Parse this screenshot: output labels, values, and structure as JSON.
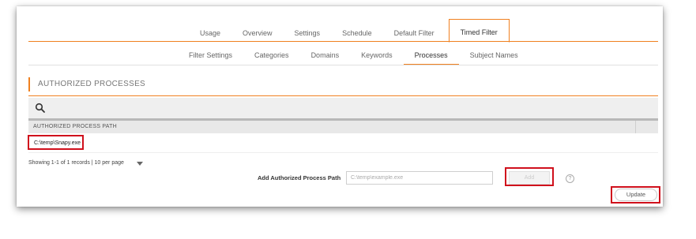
{
  "main_tabs": [
    {
      "label": "Usage"
    },
    {
      "label": "Overview"
    },
    {
      "label": "Settings"
    },
    {
      "label": "Schedule"
    },
    {
      "label": "Default Filter"
    },
    {
      "label": "Timed Filter",
      "active": true
    }
  ],
  "sub_tabs": [
    {
      "label": "Filter Settings"
    },
    {
      "label": "Categories"
    },
    {
      "label": "Domains"
    },
    {
      "label": "Keywords"
    },
    {
      "label": "Processes",
      "active": true
    },
    {
      "label": "Subject Names"
    }
  ],
  "section": {
    "title": "AUTHORIZED PROCESSES"
  },
  "search": {
    "icon": "search-icon"
  },
  "table": {
    "header": "AUTHORIZED PROCESS PATH",
    "rows": [
      {
        "path": "C:\\temp\\Snapy.exe"
      }
    ]
  },
  "pager": {
    "text": "Showing 1-1 of 1 records | 10 per page"
  },
  "add_form": {
    "label": "Add Authorized Process Path",
    "placeholder": "C:\\temp\\example.exe",
    "add_button": "Add",
    "help_icon": "?"
  },
  "update_button": "Update",
  "colors": {
    "accent": "#f0801f",
    "highlight": "#d0101c"
  }
}
